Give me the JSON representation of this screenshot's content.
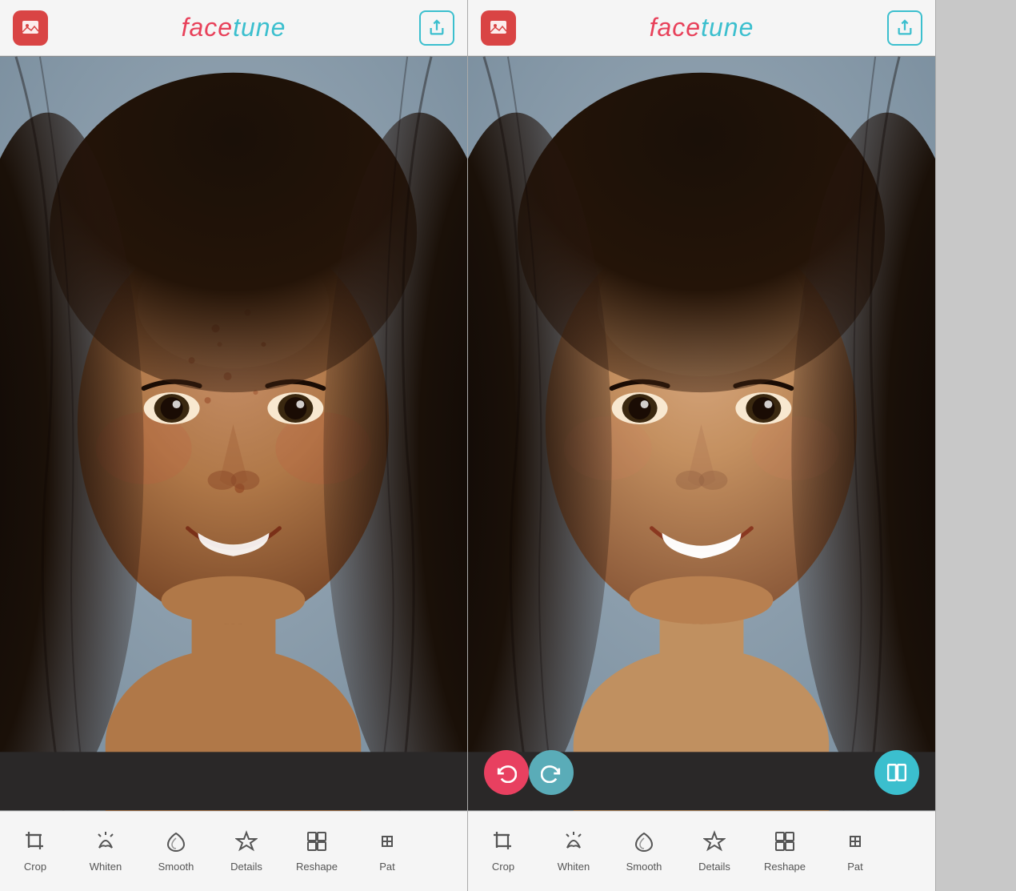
{
  "app": {
    "name_face": "face",
    "name_tune": "tune",
    "title": "facetune"
  },
  "panels": [
    {
      "id": "before",
      "type": "before",
      "has_action_buttons": false
    },
    {
      "id": "after",
      "type": "after",
      "has_action_buttons": true
    }
  ],
  "header": {
    "left_icon": "image-icon",
    "right_icon": "share-icon"
  },
  "action_buttons": [
    {
      "id": "undo",
      "icon": "↺",
      "label": "undo",
      "color": "#e84060"
    },
    {
      "id": "redo",
      "icon": "↻",
      "label": "redo",
      "color": "#5aacb8"
    },
    {
      "id": "compare",
      "icon": "⧉",
      "label": "compare",
      "color": "#3bbfce"
    }
  ],
  "toolbar": {
    "items": [
      {
        "id": "crop",
        "label": "Crop",
        "icon": "crop"
      },
      {
        "id": "whiten",
        "label": "Whiten",
        "icon": "whiten"
      },
      {
        "id": "smooth",
        "label": "Smooth",
        "icon": "smooth"
      },
      {
        "id": "details",
        "label": "Details",
        "icon": "details"
      },
      {
        "id": "reshape",
        "label": "Reshape",
        "icon": "reshape"
      },
      {
        "id": "patch",
        "label": "Pat",
        "icon": "patch"
      }
    ]
  }
}
